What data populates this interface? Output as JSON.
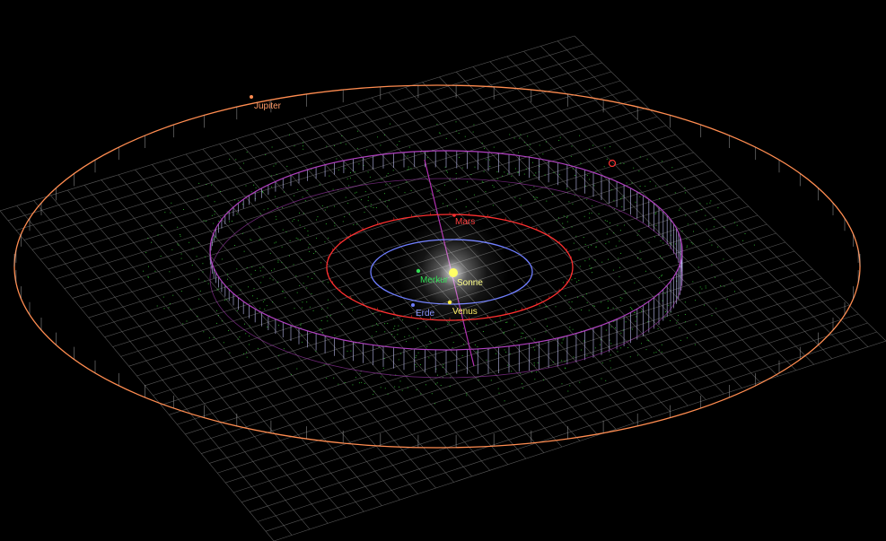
{
  "colors": {
    "background": "#000000",
    "grid": "#6a6a6a",
    "asteroids": "#3cdc3c",
    "sun": "#ffff66",
    "merkur": "#33dd55",
    "venus": "#ffee44",
    "erde": "#6e7dff",
    "mars": "#ff3030",
    "jupiter": "#ff8c50",
    "belt_ring": "#b040c0",
    "belt_ticks": "#c8c8ff",
    "sun_label": "#ffff88"
  },
  "bodies": [
    {
      "key": "sun",
      "label": "Sonne",
      "color": "#ffff66"
    },
    {
      "key": "merkur",
      "label": "Merkur",
      "color": "#33dd55"
    },
    {
      "key": "venus",
      "label": "Venus",
      "color": "#ffee44"
    },
    {
      "key": "erde",
      "label": "Erde",
      "color": "#6e7dff"
    },
    {
      "key": "mars",
      "label": "Mars",
      "color": "#ff3030"
    },
    {
      "key": "jupiter",
      "label": "Jupiter",
      "color": "#ff8c50"
    }
  ]
}
